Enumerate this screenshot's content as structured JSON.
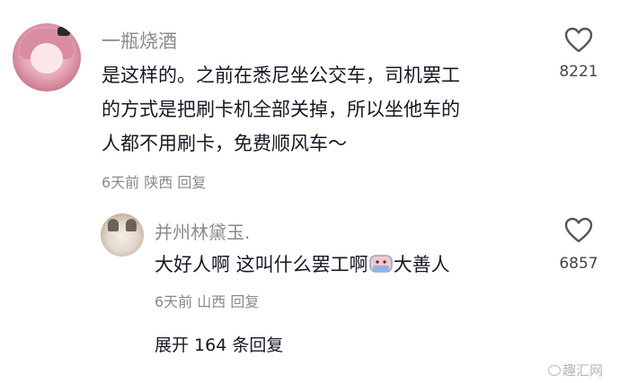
{
  "comment": {
    "username": "一瓶烧酒",
    "text_lines": [
      "是这样的。之前在悉尼坐公交车，司机罢工",
      "的方式是把刷卡机全部关掉，所以坐他车的",
      "人都不用刷卡，免费顺风车～"
    ],
    "meta": "6天前 陕西 回复",
    "like_count": "8221"
  },
  "reply": {
    "username": "并州林黛玉.",
    "text_before_emoji": "大好人啊 这叫什么罢工啊",
    "emoji_icon": "crying-face-emoji",
    "text_after_emoji": "大善人",
    "meta": "6天前 山西 回复",
    "like_count": "6857"
  },
  "expand_label": "展开 164 条回复",
  "watermark": "趣汇网",
  "colors": {
    "text": "#161823",
    "secondary": "#8a8a8a",
    "background": "#ffffff"
  }
}
